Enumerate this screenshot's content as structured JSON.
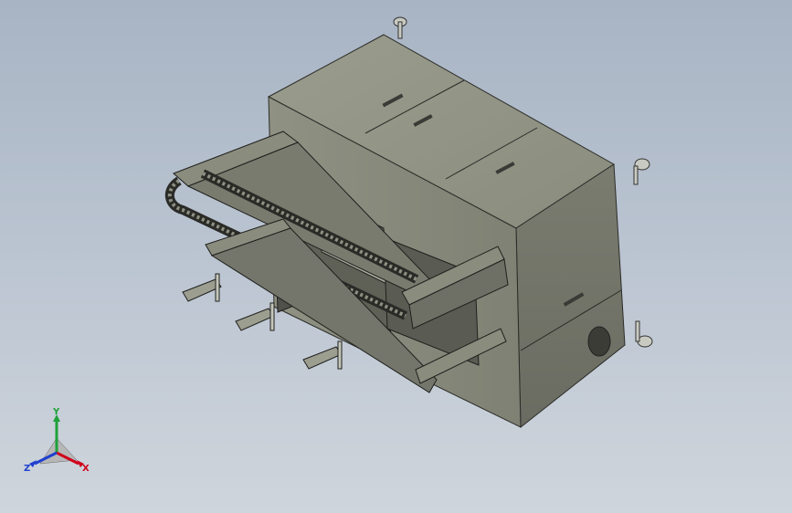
{
  "viewport": {
    "background_top": "#a8b4c4",
    "background_bottom": "#cfd5dc",
    "model_colors": {
      "body": "#8e9082",
      "body_dark": "#6f7166",
      "body_light": "#a6a899",
      "edge": "#2b2c28"
    }
  },
  "triad": {
    "x_label": "X",
    "y_label": "Y",
    "z_label": "Z",
    "x_color": "#d0021b",
    "y_color": "#1fa13a",
    "z_color": "#1f3fd0"
  }
}
